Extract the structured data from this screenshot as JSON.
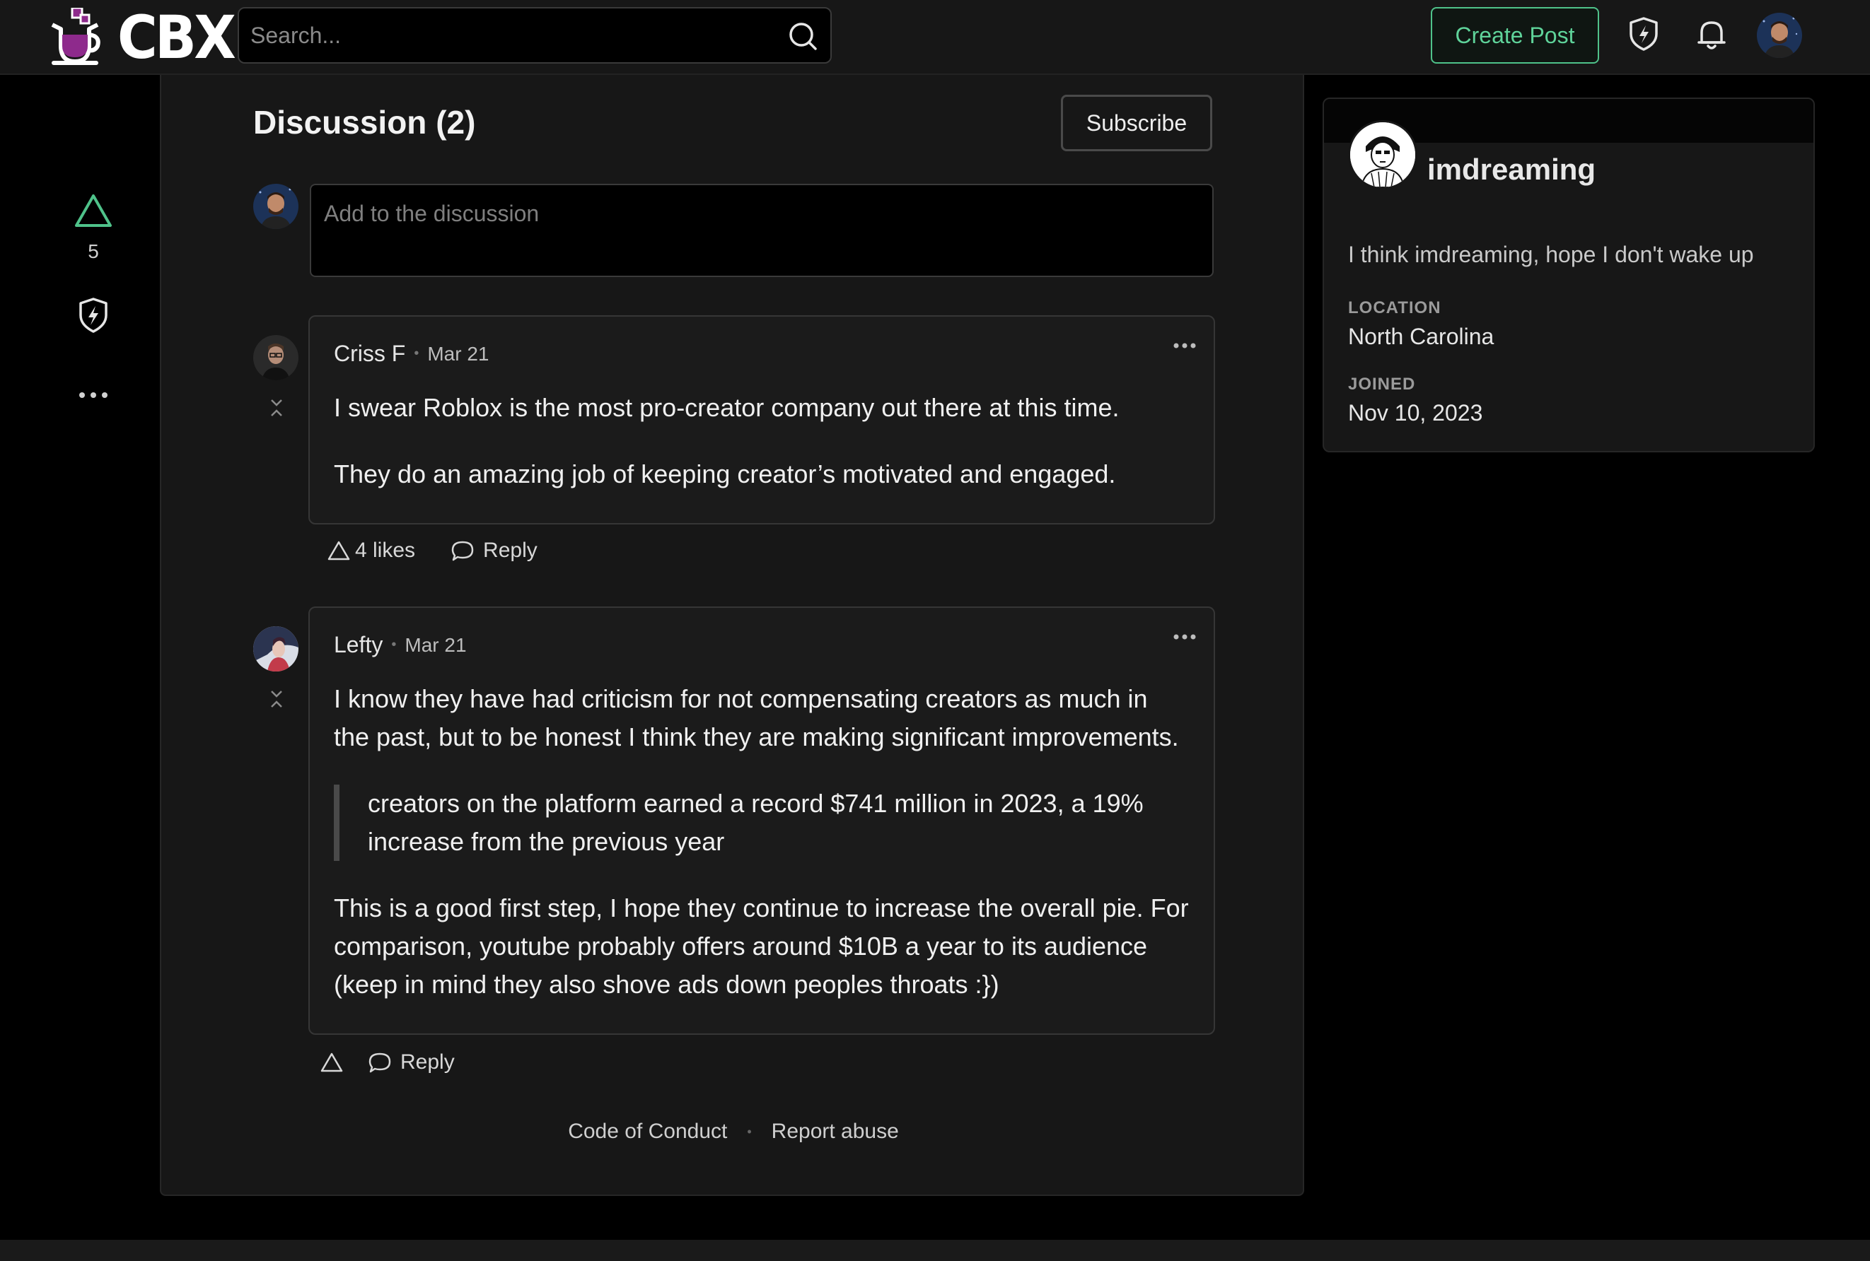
{
  "header": {
    "logo_text": "CBX",
    "search_placeholder": "Search...",
    "create_post_label": "Create Post"
  },
  "rail": {
    "vote_count": "5"
  },
  "discussion": {
    "title": "Discussion (2)",
    "subscribe_label": "Subscribe",
    "compose_placeholder": "Add to the discussion"
  },
  "comments": [
    {
      "author": "Criss F",
      "date": "Mar 21",
      "paragraphs": [
        "I swear Roblox is the most pro-creator company out there at this time.",
        "They do an amazing job of keeping creator’s motivated and engaged."
      ],
      "likes_label": "4 likes",
      "reply_label": "Reply"
    },
    {
      "author": "Lefty",
      "date": "Mar 21",
      "paragraph_1": "I know they have had criticism for not compensating creators as much in the past, but to be honest I think they are making significant improvements.",
      "quote": "creators on the platform earned a record $741 million in 2023, a 19% increase from the previous year",
      "paragraph_2": "This is a good first step, I hope they continue to increase the overall pie. For comparison, youtube probably offers around $10B a year to its audience (keep in mind they also shove ads down peoples throats :})",
      "reply_label": "Reply"
    }
  ],
  "footer": {
    "code_of_conduct": "Code of Conduct",
    "separator": "•",
    "report_abuse": "Report abuse"
  },
  "profile": {
    "username": "imdreaming",
    "bio": "I think imdreaming, hope I don't wake up",
    "location_label": "LOCATION",
    "location": "North Carolina",
    "joined_label": "JOINED",
    "joined": "Nov 10, 2023"
  },
  "colors": {
    "accent_green": "#5fd39a",
    "background": "#000000",
    "card": "#171717",
    "logo_purple": "#8e2a8c"
  },
  "icons": {
    "logo": "coffee-cup-logo-icon",
    "search": "search-icon",
    "shield": "shield-bolt-icon",
    "bell": "bell-icon",
    "upvote": "triangle-upvote-icon",
    "more": "more-horizontal-icon",
    "reply": "comment-bubble-icon",
    "collapse": "collapse-chevrons-icon"
  }
}
